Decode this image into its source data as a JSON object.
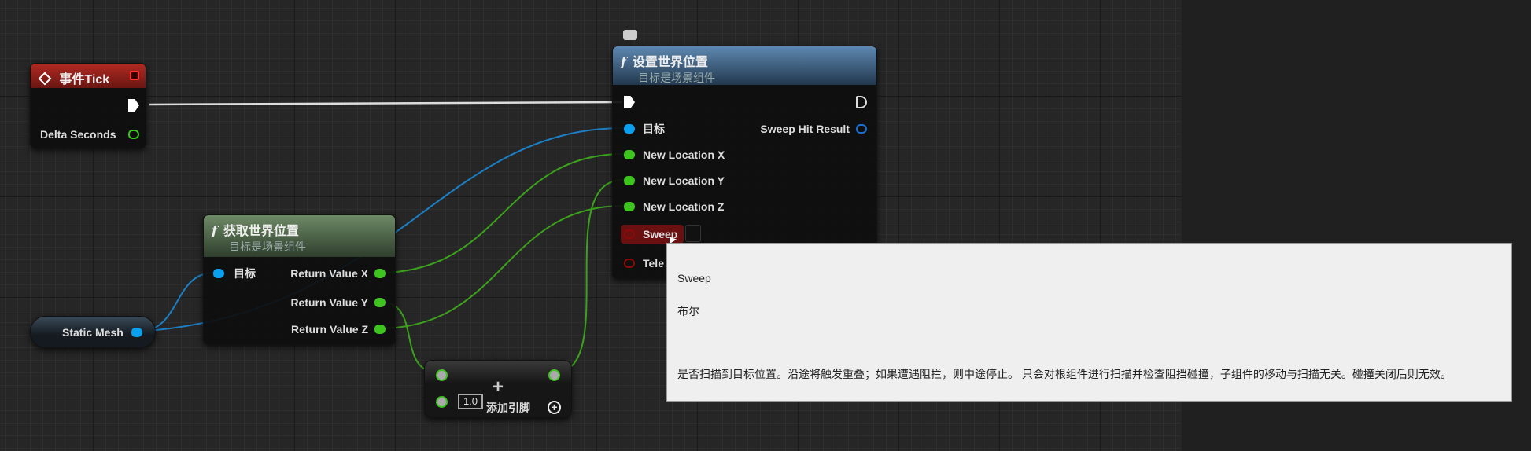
{
  "tick_node": {
    "title": "事件Tick",
    "delta": "Delta Seconds"
  },
  "get_node": {
    "title": "获取世界位置",
    "subtitle": "目标是场景组件",
    "target": "目标",
    "rx": "Return Value X",
    "ry": "Return Value Y",
    "rz": "Return Value Z"
  },
  "static_mesh": {
    "label": "Static Mesh"
  },
  "set_node": {
    "title": "设置世界位置",
    "subtitle": "目标是场景组件",
    "target": "目标",
    "nlx": "New Location X",
    "nly": "New Location Y",
    "nlz": "New Location Z",
    "sweep": "Sweep",
    "tele": "Tele",
    "hit": "Sweep Hit Result"
  },
  "add_node": {
    "value": "1.0",
    "add_pin": "添加引脚"
  },
  "tooltip": {
    "name": "Sweep",
    "type": "布尔",
    "desc": "是否扫描到目标位置。沿途将触发重叠；如果遭遇阻拦，则中途停止。 只会对根组件进行扫描并检查阻挡碰撞，子组件的移动与扫描无关。碰撞关闭后则无效。"
  },
  "colors": {
    "float": "#3ec41e",
    "object": "#0aa0f0",
    "exec": "#ffffff",
    "bool": "#8a0a0a"
  }
}
